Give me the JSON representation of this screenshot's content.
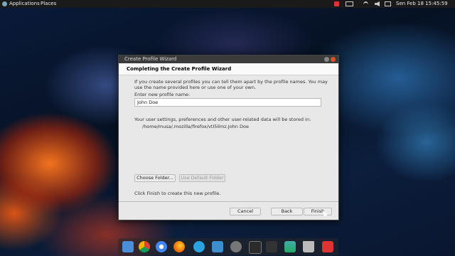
{
  "topbar": {
    "applications": "Applications",
    "places": "Places",
    "datetime": "Sen Feb 18 15:45:59",
    "icons": [
      "record-icon",
      "keyboard-icon",
      "wifi-icon",
      "volume-icon",
      "battery-icon"
    ]
  },
  "window": {
    "title": "Create Profile Wizard",
    "header": "Completing the Create Profile Wizard",
    "intro_line1": "If you create several profiles you can tell them apart by the profile names. You may",
    "intro_line2": "use the name provided here or use one of your own.",
    "enter_label": "Enter new profile name:",
    "profile_name": "John Doe",
    "storage_line1": "Your user settings, preferences and other user-related data will be stored in:",
    "storage_path": "/home/musa/.mozilla/firefox/vtI5ilmz.John Doe",
    "choose_folder": "Choose Folder...",
    "use_default": "Use Default Folder",
    "finish_hint": "Click Finish to create this new profile.",
    "cancel": "Cancel",
    "back": "Back",
    "finish": "Finish"
  },
  "dock": {
    "apps": [
      "files-icon",
      "chrome-icon",
      "chromium-icon",
      "firefox-icon",
      "telegram-icon",
      "box-icon",
      "steam-icon",
      "camera-icon",
      "terminal-icon",
      "notes-icon",
      "monitor-icon",
      "trash-icon",
      "app-icon"
    ]
  },
  "colors": {
    "topbar": "#1a1a1a",
    "window_bg": "#e8e8e8",
    "titlebar": "#3b3b3b",
    "close_button": "#e0502a"
  }
}
